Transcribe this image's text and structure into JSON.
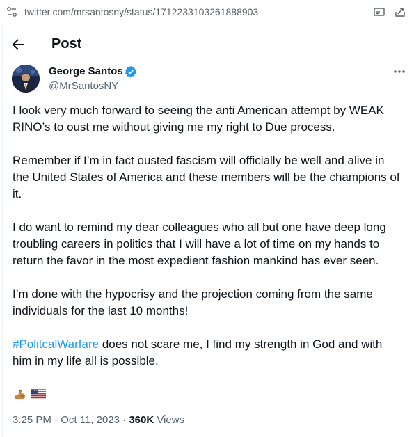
{
  "browser": {
    "url": "twitter.com/mrsantosny/status/1712233103261888903",
    "icons": [
      "site-settings-icon",
      "cast-icon",
      "share-icon"
    ]
  },
  "header": {
    "back_icon": "arrow-left-icon",
    "title": "Post"
  },
  "author": {
    "name": "George Santos",
    "handle": "@MrSantosNY",
    "verified": true,
    "verified_color": "#1d9bf0"
  },
  "tweet": {
    "paragraphs": [
      "I look very much forward to seeing the anti American attempt by WEAK RINO’s to oust me without giving me my right to Due process.",
      "Remember if I’m in fact ousted fascism will officially be well and alive in the United States of America and these members will be the champions of it.",
      "I do want to remind my dear colleagues who all but one have deep long troubling careers in politics that I will have a lot of time on my hands to return the favor in the most expedient fashion mankind has ever seen.",
      "I’m done with the hypocrisy and the projection coming from the same individuals for the last 10 months!"
    ],
    "hashtag": "#PolitcalWarfare",
    "last_paragraph_rest": " does not scare me, I find my strength in God and with him in my life all is possible.",
    "emojis": [
      "flexed-biceps-emoji",
      "us-flag-emoji"
    ]
  },
  "meta": {
    "timestamp": "3:25 PM · Oct 11, 2023",
    "separator": " · ",
    "views_count": "360K",
    "views_label": " Views"
  },
  "colors": {
    "link": "#1d9bf0",
    "secondary_text": "#536471",
    "primary_text": "#0f1419"
  }
}
